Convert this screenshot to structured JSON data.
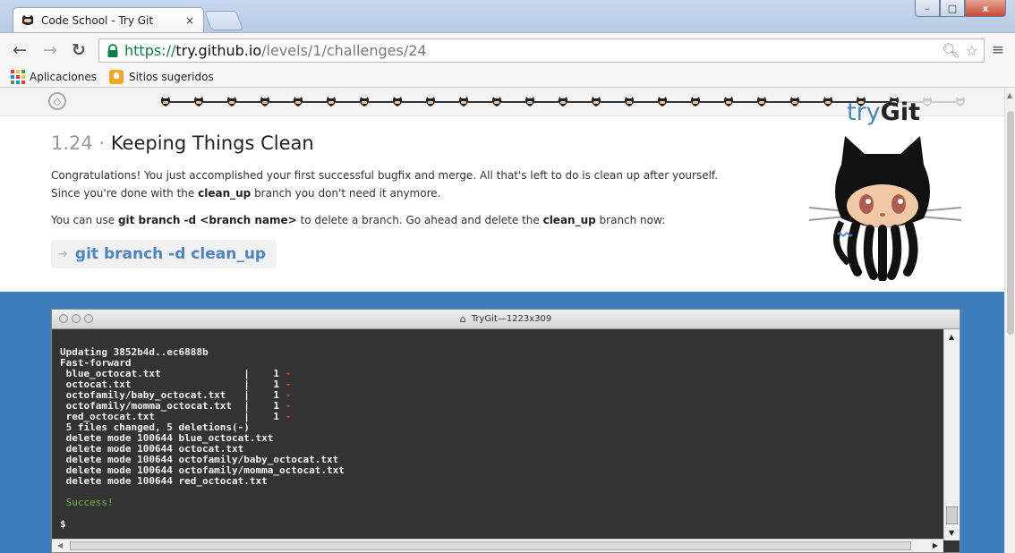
{
  "browser": {
    "tab_title": "Code School - Try Git",
    "tab_close": "×",
    "url_scheme": "https://",
    "url_host": "try.github.io",
    "url_path": "/levels/1/challenges/24",
    "window_buttons": {
      "minimize": "–",
      "maximize": "□",
      "close": "x"
    }
  },
  "bookmarks": [
    {
      "label": "Aplicaciones",
      "icon": "apps-grid-icon"
    },
    {
      "label": "Sitios sugeridos",
      "icon": "lightbulb-icon"
    }
  ],
  "progress": {
    "total_steps": 25,
    "completed_steps": 23,
    "active_color": "#222222",
    "pending_color": "#cccccc"
  },
  "lesson": {
    "number": "1.24",
    "separator": "·",
    "title": "Keeping Things Clean",
    "p1_a": "Congratulations! You just accomplished your first successful bugfix and merge. All that's left to do is clean up after yourself.",
    "p1_b_pre": "Since you're done with the ",
    "p1_b_bold": "clean_up",
    "p1_b_post": " branch you don't need it anymore.",
    "p2_pre": "You can use ",
    "p2_bold1": "git branch -d <branch name>",
    "p2_mid": " to delete a branch. Go ahead and delete the ",
    "p2_bold2": "clean_up",
    "p2_post": " branch now:",
    "command": "git branch -d clean_up"
  },
  "logo": {
    "prefix": "try",
    "suffix": "Git"
  },
  "terminal": {
    "title": "TryGit—1223x309",
    "lines": [
      {
        "text": "Updating 3852b4d..ec6888b"
      },
      {
        "text": "Fast-forward"
      },
      {
        "text": " blue_octocat.txt              |    1 ",
        "minus": "-"
      },
      {
        "text": " octocat.txt                   |    1 ",
        "minus": "-"
      },
      {
        "text": " octofamily/baby_octocat.txt   |    1 ",
        "minus": "-"
      },
      {
        "text": " octofamily/momma_octocat.txt  |    1 ",
        "minus": "-"
      },
      {
        "text": " red_octocat.txt               |    1 ",
        "minus": "-"
      },
      {
        "text": " 5 files changed, 5 deletions(-)"
      },
      {
        "text": " delete mode 100644 blue_octocat.txt"
      },
      {
        "text": " delete mode 100644 octocat.txt"
      },
      {
        "text": " delete mode 100644 octofamily/baby_octocat.txt"
      },
      {
        "text": " delete mode 100644 octofamily/momma_octocat.txt"
      },
      {
        "text": " delete mode 100644 red_octocat.txt"
      }
    ],
    "success": " Success!",
    "prompt": "$"
  },
  "colors": {
    "accent_blue": "#4a86c5",
    "terminal_bg": "#333333",
    "page_band": "#3b7dbd",
    "success_green": "#5fbf3d",
    "minus_red": "#e03c3c"
  }
}
